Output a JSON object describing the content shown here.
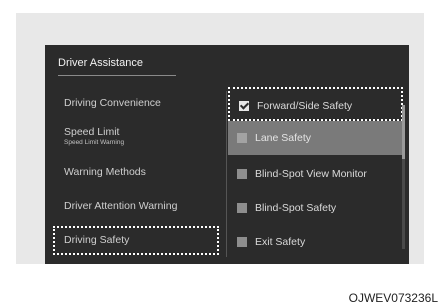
{
  "screen": {
    "title": "Driver Assistance",
    "left_menu": [
      {
        "label": "Driving Convenience",
        "sub": ""
      },
      {
        "label": "Speed Limit",
        "sub": "Speed Limit Warning"
      },
      {
        "label": "Warning Methods",
        "sub": ""
      },
      {
        "label": "Driver Attention Warning",
        "sub": ""
      },
      {
        "label": "Driving Safety",
        "sub": ""
      }
    ],
    "right_menu": [
      {
        "label": "Forward/Side Safety",
        "checked": true
      },
      {
        "label": "Lane Safety",
        "checked": false
      },
      {
        "label": "Blind-Spot View Monitor",
        "checked": false
      },
      {
        "label": "Blind-Spot Safety",
        "checked": false
      },
      {
        "label": "Exit Safety",
        "checked": false
      }
    ]
  },
  "caption": "OJWEV073236L"
}
